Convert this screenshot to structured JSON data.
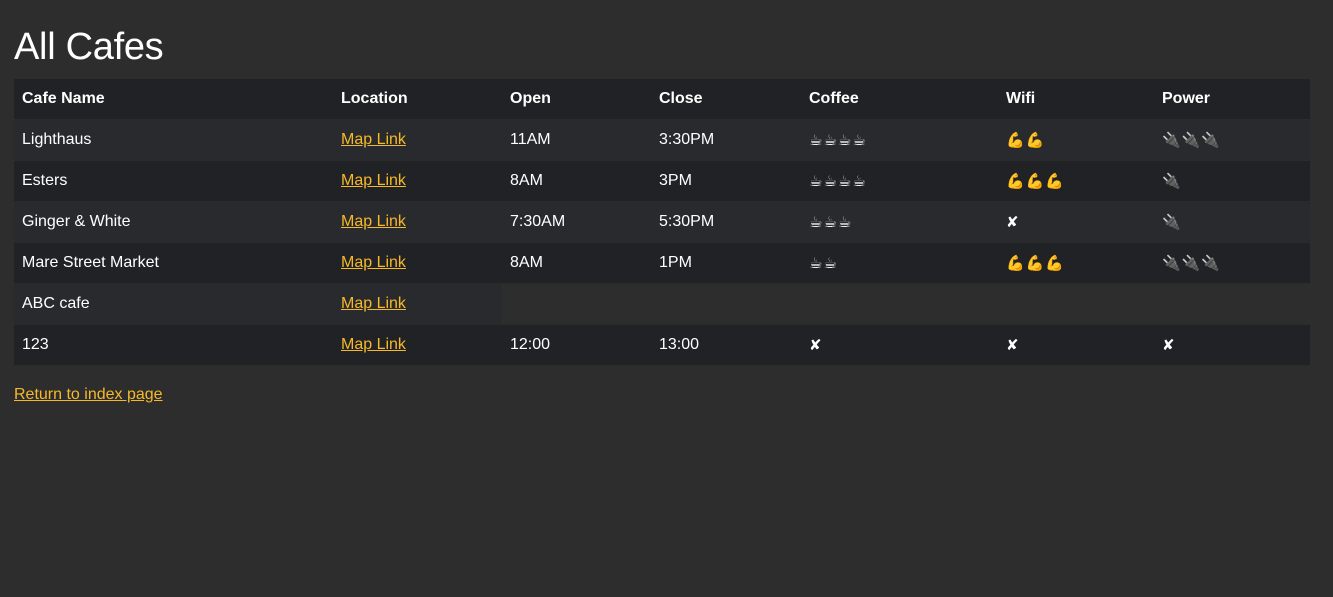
{
  "page": {
    "title": "All Cafes",
    "return_link": "Return to index page"
  },
  "table": {
    "headers": [
      "Cafe Name",
      "Location",
      "Open",
      "Close",
      "Coffee",
      "Wifi",
      "Power"
    ],
    "rows": [
      {
        "name": "Lighthaus",
        "location": "Map Link",
        "open": "11AM",
        "close": "3:30PM",
        "coffee": "☕☕☕☕",
        "wifi": "💪💪",
        "power": "🔌🔌🔌"
      },
      {
        "name": "Esters",
        "location": "Map Link",
        "open": "8AM",
        "close": "3PM",
        "coffee": "☕☕☕☕",
        "wifi": "💪💪💪",
        "power": "🔌"
      },
      {
        "name": "Ginger & White",
        "location": "Map Link",
        "open": "7:30AM",
        "close": "5:30PM",
        "coffee": "☕☕☕",
        "wifi": "✘",
        "power": "🔌"
      },
      {
        "name": "Mare Street Market",
        "location": "Map Link",
        "open": "8AM",
        "close": "1PM",
        "coffee": "☕☕",
        "wifi": "💪💪💪",
        "power": "🔌🔌🔌"
      },
      {
        "name": "ABC cafe",
        "location": "Map Link",
        "open": "",
        "close": "",
        "coffee": "",
        "wifi": "",
        "power": ""
      },
      {
        "name": "123",
        "location": "Map Link",
        "open": "12:00",
        "close": "13:00",
        "coffee": "✘",
        "wifi": "✘",
        "power": "✘"
      }
    ]
  }
}
